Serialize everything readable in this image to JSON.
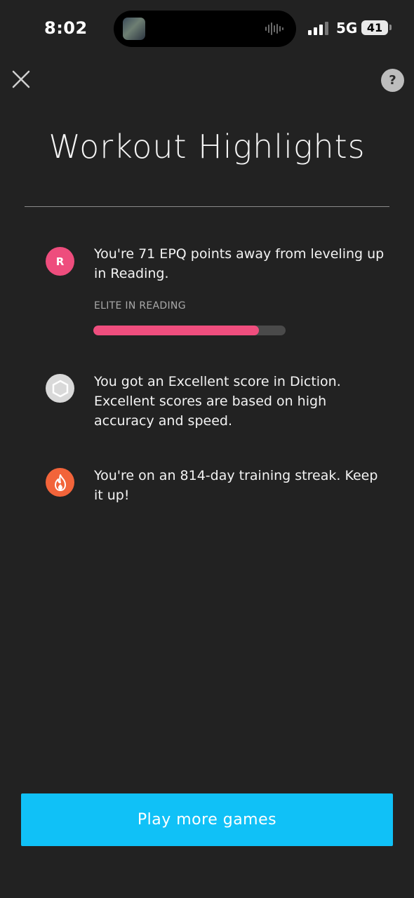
{
  "status_bar": {
    "time": "8:02",
    "network": "5G",
    "battery": "41"
  },
  "header": {
    "close_icon": "close-icon",
    "help_label": "?",
    "title": "Workout Highlights"
  },
  "highlights": [
    {
      "icon": "reading-badge-icon",
      "icon_letter": "R",
      "icon_color": "#ee4d7d",
      "text": "You're 71 EPQ points away from leveling up in Reading.",
      "progress_label": "ELITE IN READING",
      "progress_fraction": 0.86
    },
    {
      "icon": "hexagon-icon",
      "icon_color": "#d9d9d9",
      "text": "You got an Excellent score in Diction. Excellent scores are based on high accuracy and speed."
    },
    {
      "icon": "flame-icon",
      "icon_color": "#f2643a",
      "text": "You're on an 814-day training streak. Keep it up!"
    }
  ],
  "footer": {
    "play_button_label": "Play more games",
    "accent_color": "#10c1f7"
  }
}
